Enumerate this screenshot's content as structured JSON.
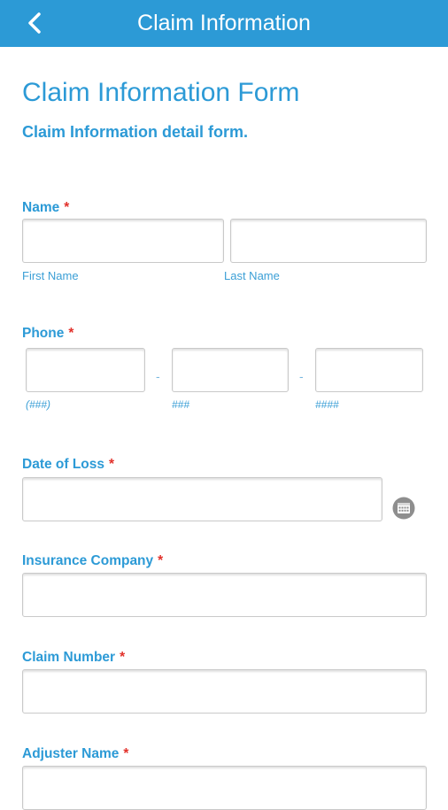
{
  "header": {
    "title": "Claim Information"
  },
  "form": {
    "title": "Claim Information Form",
    "subtitle": "Claim Information detail form.",
    "required_marker": "*",
    "name": {
      "label": "Name",
      "first_sub": "First Name",
      "last_sub": "Last Name",
      "first_value": "",
      "last_value": ""
    },
    "phone": {
      "label": "Phone",
      "area_sub": "(###)",
      "prefix_sub": "###",
      "line_sub": "####",
      "separator": "-"
    },
    "date_of_loss": {
      "label": "Date of Loss",
      "value": ""
    },
    "insurance_company": {
      "label": "Insurance Company",
      "value": ""
    },
    "claim_number": {
      "label": "Claim Number",
      "value": ""
    },
    "adjuster_name": {
      "label": "Adjuster Name",
      "value": ""
    }
  },
  "colors": {
    "accent": "#2c9ad6",
    "required": "#e2312b",
    "icon_gray": "#8e8e8e"
  },
  "icons": {
    "back": "chevron-left-icon",
    "calendar": "calendar-icon"
  }
}
